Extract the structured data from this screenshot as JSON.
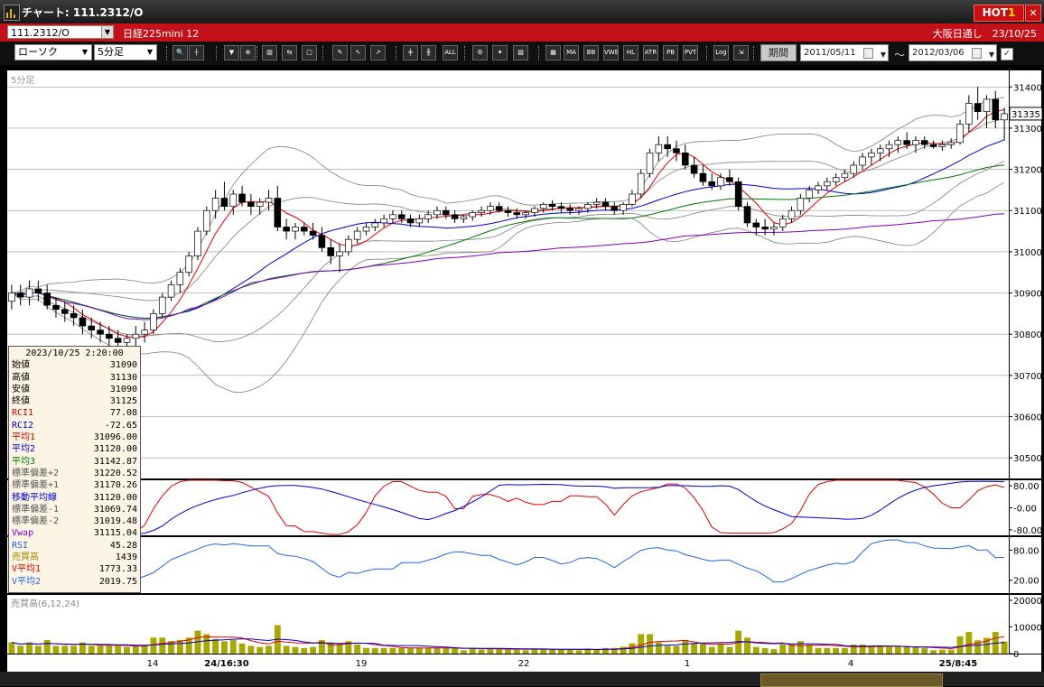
{
  "window": {
    "title": "チャート: 111.2312/O",
    "hot_label": "HOT",
    "hot_num": "1",
    "close": "✕"
  },
  "infobar": {
    "symbol": "111.2312/O",
    "name": "日経225mini 12",
    "session": "大阪日通し　23/10/25"
  },
  "toolbar": {
    "chart_type": "ローソク",
    "timeframe": "5分足",
    "period_button": "期間",
    "date_from": "2011/05/11",
    "date_to": "2012/03/06",
    "tilde": "～",
    "icons": [
      {
        "name": "zoom-icon",
        "label": "🔍"
      },
      {
        "name": "crosshair-icon",
        "label": "┼"
      },
      {
        "name": "pin-icon",
        "label": "▼"
      },
      {
        "name": "zoom-in-icon",
        "label": "⊕"
      },
      {
        "name": "chart-icon",
        "label": "▥"
      },
      {
        "name": "compare-icon",
        "label": "⇆"
      },
      {
        "name": "clear-icon",
        "label": "□"
      },
      {
        "name": "pencil-icon",
        "label": "✎"
      },
      {
        "name": "cursor-icon",
        "label": "↖"
      },
      {
        "name": "arrow-icon",
        "label": "↗"
      },
      {
        "name": "candle-a-icon",
        "label": "╪"
      },
      {
        "name": "candle-b-icon",
        "label": "╫"
      },
      {
        "name": "all-icon",
        "label": "ALL"
      },
      {
        "name": "settings-icon",
        "label": "⚙"
      },
      {
        "name": "tools-icon",
        "label": "✦"
      },
      {
        "name": "color-icon",
        "label": "▧"
      },
      {
        "name": "grid-icon",
        "label": "▦"
      },
      {
        "name": "ma-icon",
        "label": "MA"
      },
      {
        "name": "bb-icon",
        "label": "BB"
      },
      {
        "name": "vwap-icon",
        "label": "VWE"
      },
      {
        "name": "hl-icon",
        "label": "HL"
      },
      {
        "name": "atr-icon",
        "label": "ATR"
      },
      {
        "name": "pb-icon",
        "label": "PB"
      },
      {
        "name": "pvt-icon",
        "label": "PVT"
      },
      {
        "name": "log-icon",
        "label": "Log"
      },
      {
        "name": "export-icon",
        "label": "⇲"
      }
    ]
  },
  "timeframe_label": "5分足",
  "colors": {
    "up_candle": "#ffffff",
    "down_candle": "#000000",
    "ma1": "#e00000",
    "ma2": "#0000cc",
    "ma3": "#007a00",
    "vwap": "#8000c0",
    "bollinger": "#808080",
    "rsi": "#1f66e0",
    "volume": "#a8a800",
    "vol_ma1": "#e00000",
    "vol_ma2": "#0000cc"
  },
  "info_panel": {
    "datetime": "2023/10/25 2:20:00",
    "rows": [
      {
        "label": "始値",
        "value": "31090",
        "color": "#000000"
      },
      {
        "label": "高値",
        "value": "31130",
        "color": "#000000"
      },
      {
        "label": "安値",
        "value": "31090",
        "color": "#000000"
      },
      {
        "label": "終値",
        "value": "31125",
        "color": "#000000"
      },
      {
        "label": "RCI1",
        "value": "77.08",
        "color": "#d00000"
      },
      {
        "label": "RCI2",
        "value": "-72.65",
        "color": "#0000cc"
      },
      {
        "label": "平均1",
        "value": "31096.00",
        "color": "#d00000"
      },
      {
        "label": "平均2",
        "value": "31120.00",
        "color": "#0000cc"
      },
      {
        "label": "平均3",
        "value": "31142.87",
        "color": "#007a00"
      },
      {
        "label": "標準偏差+2",
        "value": "31220.52",
        "color": "#555555"
      },
      {
        "label": "標準偏差+1",
        "value": "31170.26",
        "color": "#555555"
      },
      {
        "label": "移動平均線",
        "value": "31120.00",
        "color": "#0000cc"
      },
      {
        "label": "標準偏差-1",
        "value": "31069.74",
        "color": "#555555"
      },
      {
        "label": "標準偏差-2",
        "value": "31019.48",
        "color": "#555555"
      },
      {
        "label": "Vwap",
        "value": "31115.04",
        "color": "#8000c0"
      },
      {
        "label": "RSI",
        "value": "45.28",
        "color": "#1f66e0"
      },
      {
        "label": "売買高",
        "value": "1439",
        "color": "#a08800"
      },
      {
        "label": "V平均1",
        "value": "1773.33",
        "color": "#d00000"
      },
      {
        "label": "V平均2",
        "value": "2019.75",
        "color": "#1f66e0"
      }
    ]
  },
  "price_panel": {
    "ticks": [
      "31400",
      "31300",
      "31200",
      "31100",
      "31000",
      "30900",
      "30800",
      "30700",
      "30600",
      "30500"
    ],
    "last_price": "31335"
  },
  "rci_panel": {
    "ticks": [
      "80.00",
      "-0.00",
      "-80.00"
    ]
  },
  "rsi_panel": {
    "ticks": [
      "80.00",
      "20.00"
    ]
  },
  "volume_panel": {
    "label": "売買高(6,12,24)",
    "ticks": [
      "20000",
      "10000",
      "0"
    ]
  },
  "x_axis": {
    "labels": [
      {
        "text": "14",
        "bold": false
      },
      {
        "text": "24/16:30",
        "bold": true
      },
      {
        "text": "19",
        "bold": false
      },
      {
        "text": "22",
        "bold": false
      },
      {
        "text": "1",
        "bold": false
      },
      {
        "text": "4",
        "bold": false
      },
      {
        "text": "25/8:45",
        "bold": true
      }
    ]
  },
  "chart_data": {
    "type": "candlestick",
    "timeframe": "5分足",
    "price_ylim": [
      30450,
      31440
    ],
    "candles": [
      [
        30880,
        30920,
        30860,
        30900
      ],
      [
        30900,
        30920,
        30870,
        30890
      ],
      [
        30890,
        30930,
        30870,
        30910
      ],
      [
        30910,
        30930,
        30880,
        30900
      ],
      [
        30900,
        30920,
        30860,
        30870
      ],
      [
        30870,
        30890,
        30840,
        30860
      ],
      [
        30860,
        30880,
        30830,
        30850
      ],
      [
        30850,
        30870,
        30820,
        30840
      ],
      [
        30840,
        30860,
        30800,
        30820
      ],
      [
        30820,
        30840,
        30790,
        30810
      ],
      [
        30810,
        30830,
        30780,
        30800
      ],
      [
        30800,
        30820,
        30770,
        30790
      ],
      [
        30790,
        30810,
        30760,
        30780
      ],
      [
        30780,
        30800,
        30760,
        30790
      ],
      [
        30790,
        30820,
        30770,
        30800
      ],
      [
        30800,
        30830,
        30780,
        30810
      ],
      [
        30810,
        30860,
        30800,
        30850
      ],
      [
        30850,
        30900,
        30840,
        30890
      ],
      [
        30890,
        30930,
        30880,
        30920
      ],
      [
        30920,
        30960,
        30900,
        30950
      ],
      [
        30950,
        31000,
        30940,
        30990
      ],
      [
        30990,
        31060,
        30980,
        31050
      ],
      [
        31050,
        31110,
        31040,
        31100
      ],
      [
        31100,
        31150,
        31080,
        31130
      ],
      [
        31130,
        31170,
        31100,
        31110
      ],
      [
        31110,
        31150,
        31090,
        31140
      ],
      [
        31140,
        31160,
        31110,
        31120
      ],
      [
        31120,
        31140,
        31090,
        31110
      ],
      [
        31110,
        31130,
        31090,
        31120
      ],
      [
        31120,
        31150,
        31100,
        31130
      ],
      [
        31130,
        31160,
        31050,
        31060
      ],
      [
        31060,
        31080,
        31030,
        31050
      ],
      [
        31050,
        31070,
        31030,
        31060
      ],
      [
        31060,
        31070,
        31040,
        31050
      ],
      [
        31050,
        31070,
        31030,
        31040
      ],
      [
        31040,
        31060,
        31000,
        31010
      ],
      [
        31010,
        31030,
        30970,
        30990
      ],
      [
        30990,
        31020,
        30950,
        31000
      ],
      [
        31000,
        31040,
        30990,
        31030
      ],
      [
        31030,
        31060,
        31020,
        31050
      ],
      [
        31050,
        31070,
        31040,
        31060
      ],
      [
        31060,
        31080,
        31050,
        31070
      ],
      [
        31070,
        31090,
        31060,
        31080
      ],
      [
        31080,
        31100,
        31070,
        31090
      ],
      [
        31090,
        31100,
        31070,
        31080
      ],
      [
        31080,
        31090,
        31060,
        31070
      ],
      [
        31070,
        31090,
        31060,
        31080
      ],
      [
        31080,
        31100,
        31070,
        31090
      ],
      [
        31090,
        31110,
        31080,
        31100
      ],
      [
        31100,
        31110,
        31080,
        31090
      ],
      [
        31090,
        31100,
        31070,
        31080
      ],
      [
        31080,
        31090,
        31070,
        31085
      ],
      [
        31085,
        31100,
        31075,
        31095
      ],
      [
        31095,
        31110,
        31085,
        31100
      ],
      [
        31100,
        31120,
        31090,
        31110
      ],
      [
        31110,
        31120,
        31095,
        31100
      ],
      [
        31100,
        31110,
        31085,
        31095
      ],
      [
        31095,
        31105,
        31080,
        31090
      ],
      [
        31090,
        31100,
        31080,
        31095
      ],
      [
        31095,
        31110,
        31085,
        31105
      ],
      [
        31105,
        31120,
        31095,
        31115
      ],
      [
        31115,
        31125,
        31100,
        31110
      ],
      [
        31110,
        31120,
        31095,
        31105
      ],
      [
        31105,
        31115,
        31090,
        31100
      ],
      [
        31100,
        31110,
        31090,
        31105
      ],
      [
        31105,
        31120,
        31095,
        31115
      ],
      [
        31115,
        31130,
        31105,
        31120
      ],
      [
        31120,
        31130,
        31100,
        31110
      ],
      [
        31110,
        31120,
        31090,
        31100
      ],
      [
        31100,
        31120,
        31090,
        31115
      ],
      [
        31115,
        31150,
        31110,
        31140
      ],
      [
        31140,
        31200,
        31130,
        31190
      ],
      [
        31190,
        31250,
        31180,
        31240
      ],
      [
        31240,
        31280,
        31220,
        31260
      ],
      [
        31260,
        31280,
        31230,
        31250
      ],
      [
        31250,
        31270,
        31220,
        31240
      ],
      [
        31240,
        31260,
        31200,
        31210
      ],
      [
        31210,
        31230,
        31180,
        31190
      ],
      [
        31190,
        31210,
        31160,
        31170
      ],
      [
        31170,
        31190,
        31150,
        31160
      ],
      [
        31160,
        31190,
        31150,
        31180
      ],
      [
        31180,
        31200,
        31160,
        31170
      ],
      [
        31170,
        31180,
        31100,
        31110
      ],
      [
        31110,
        31120,
        31060,
        31070
      ],
      [
        31070,
        31080,
        31040,
        31060
      ],
      [
        31060,
        31080,
        31040,
        31055
      ],
      [
        31055,
        31070,
        31040,
        31060
      ],
      [
        31060,
        31090,
        31050,
        31080
      ],
      [
        31080,
        31110,
        31070,
        31100
      ],
      [
        31100,
        31140,
        31090,
        31130
      ],
      [
        31130,
        31160,
        31120,
        31150
      ],
      [
        31150,
        31170,
        31140,
        31160
      ],
      [
        31160,
        31180,
        31150,
        31170
      ],
      [
        31170,
        31190,
        31160,
        31180
      ],
      [
        31180,
        31200,
        31170,
        31190
      ],
      [
        31190,
        31220,
        31180,
        31210
      ],
      [
        31210,
        31240,
        31200,
        31230
      ],
      [
        31230,
        31250,
        31210,
        31240
      ],
      [
        31240,
        31260,
        31220,
        31250
      ],
      [
        31250,
        31270,
        31230,
        31260
      ],
      [
        31260,
        31280,
        31240,
        31270
      ],
      [
        31270,
        31290,
        31250,
        31260
      ],
      [
        31260,
        31280,
        31240,
        31270
      ],
      [
        31270,
        31280,
        31250,
        31260
      ],
      [
        31260,
        31270,
        31250,
        31255
      ],
      [
        31255,
        31270,
        31245,
        31260
      ],
      [
        31260,
        31275,
        31250,
        31265
      ],
      [
        31265,
        31320,
        31260,
        31310
      ],
      [
        31310,
        31380,
        31290,
        31360
      ],
      [
        31360,
        31400,
        31320,
        31340
      ],
      [
        31340,
        31380,
        31300,
        31370
      ],
      [
        31370,
        31390,
        31300,
        31320
      ],
      [
        31320,
        31350,
        31270,
        31335
      ]
    ],
    "volume_ylim": [
      0,
      22000
    ]
  }
}
